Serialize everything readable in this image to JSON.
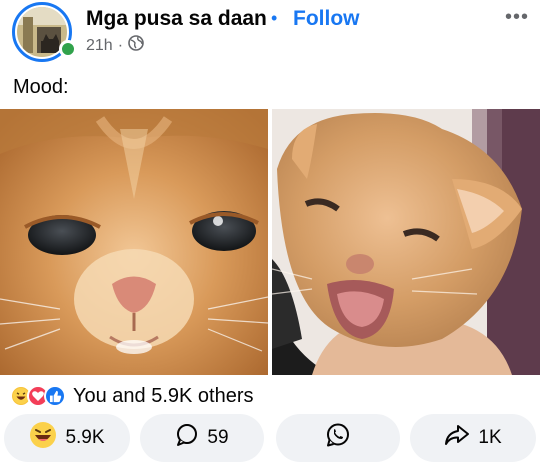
{
  "post": {
    "page_name": "Mga pusa sa daan",
    "separator": "•",
    "follow_label": "Follow",
    "time": "21h",
    "meta_separator": "·",
    "audience_icon": "globe-icon",
    "more_label": "•••",
    "caption": "Mood:",
    "images": [
      {
        "name": "kitten-closeup-photo",
        "icon": "photo"
      },
      {
        "name": "kitten-meowing-photo",
        "icon": "photo"
      }
    ]
  },
  "reactions": {
    "icons": [
      "haha-icon",
      "love-icon",
      "like-icon"
    ],
    "summary": "You and 5.9K others"
  },
  "actions": {
    "reaction_count": "5.9K",
    "comment_count": "59",
    "share_count": "1K",
    "reaction_icon": "haha-icon",
    "comment_icon": "comment-icon",
    "whatsapp_icon": "whatsapp-icon",
    "share_icon": "share-icon"
  },
  "colors": {
    "accent": "#1877f2",
    "online": "#31a24c",
    "muted": "#65676b",
    "pill_bg": "#f0f2f5"
  }
}
